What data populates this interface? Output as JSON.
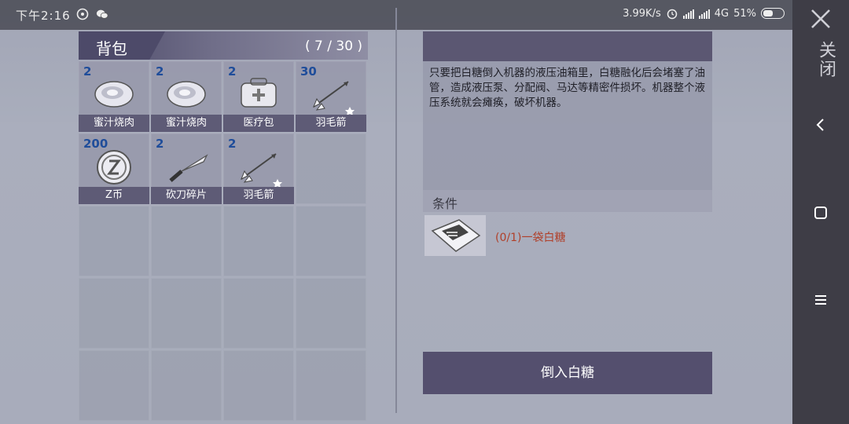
{
  "status_bar": {
    "time": "下午2:16",
    "speed": "3.99K/s",
    "network": "4G",
    "battery": "51%"
  },
  "side_bar": {
    "close_label": "关闭"
  },
  "bag": {
    "title": "背包",
    "count": "( 7 / 30 )",
    "items": [
      {
        "qty": "2",
        "name": "蜜汁烧肉",
        "icon": "meat-icon"
      },
      {
        "qty": "2",
        "name": "蜜汁烧肉",
        "icon": "meat-icon"
      },
      {
        "qty": "2",
        "name": "医疗包",
        "icon": "medkit-icon"
      },
      {
        "qty": "30",
        "name": "羽毛箭",
        "icon": "arrow-icon"
      },
      {
        "qty": "200",
        "name": "Z币",
        "icon": "coin-icon"
      },
      {
        "qty": "2",
        "name": "砍刀碎片",
        "icon": "machete-icon"
      },
      {
        "qty": "2",
        "name": "羽毛箭",
        "icon": "arrow-icon"
      }
    ]
  },
  "detail": {
    "description": "只要把白糖倒入机器的液压油箱里，白糖融化后会堵塞了油管，造成液压泵、分配阀、马达等精密件损坏。机器整个液压系统就会瘫痪，破坏机器。",
    "condition_title": "条件",
    "condition_item": "(0/1)一袋白糖",
    "action_label": "倒入白糖"
  },
  "colors": {
    "qty": "#1f4d9a",
    "condition": "#b0402a",
    "button": "#544f6e"
  }
}
